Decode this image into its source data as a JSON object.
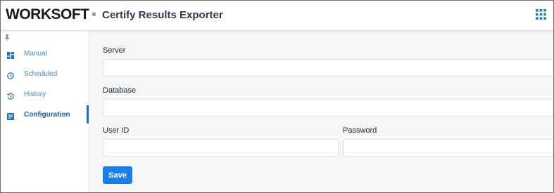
{
  "header": {
    "logo_text": "WORKSOFT",
    "logo_mark": "®",
    "title": "Certify Results Exporter",
    "apps_icon": "apps-grid-icon"
  },
  "sidebar": {
    "pin_icon": "pin-icon",
    "items": [
      {
        "label": "Manual",
        "icon": "dashboard-icon",
        "active": false
      },
      {
        "label": "Scheduled",
        "icon": "clock-icon",
        "active": false
      },
      {
        "label": "History",
        "icon": "history-icon",
        "active": false
      },
      {
        "label": "Configuration",
        "icon": "config-icon",
        "active": true
      }
    ]
  },
  "form": {
    "server": {
      "label": "Server",
      "value": "",
      "placeholder": ""
    },
    "database": {
      "label": "Database",
      "value": "",
      "placeholder": ""
    },
    "user_id": {
      "label": "User ID",
      "value": "",
      "placeholder": ""
    },
    "password": {
      "label": "Password",
      "value": "",
      "placeholder": ""
    },
    "save_label": "Save"
  },
  "colors": {
    "accent": "#1a7fe8",
    "nav_text": "#4a86b7",
    "nav_active": "#1d5f95",
    "active_bar": "#1f73b7",
    "content_bg": "#f4f6f8"
  }
}
